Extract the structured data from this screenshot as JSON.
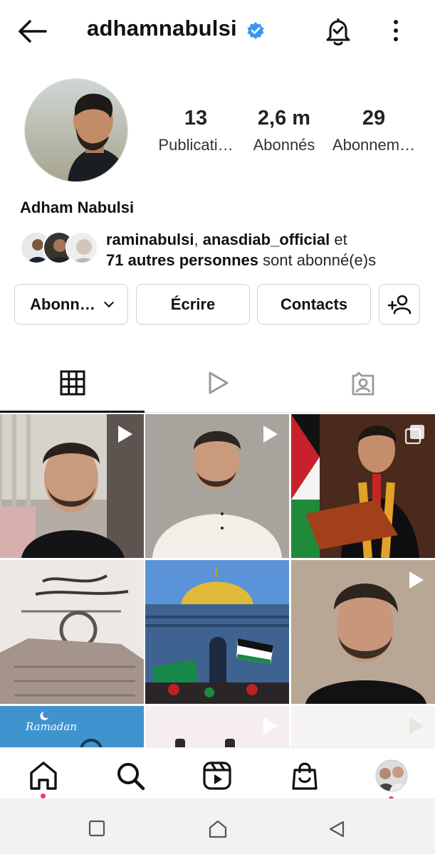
{
  "header": {
    "username": "adhamnabulsi",
    "verified": true,
    "icons": [
      "arrow-left-icon",
      "verified-badge-icon",
      "bell-check-icon",
      "more-vertical-icon"
    ]
  },
  "profile": {
    "full_name": "Adham Nabulsi",
    "stats": [
      {
        "value": "13",
        "label": "Publicati…"
      },
      {
        "value": "2,6 m",
        "label": "Abonnés"
      },
      {
        "value": "29",
        "label": "Abonnem…"
      }
    ],
    "mutual": {
      "user1": "raminabulsi",
      "sep": ", ",
      "user2": "anasdiab_official",
      "et": " et",
      "others": "71 autres personnes",
      "suffix": " sont abonné(e)s"
    }
  },
  "actions": {
    "follow_label": "Abonn…",
    "write_label": "Écrire",
    "contacts_label": "Contacts"
  },
  "tabs": [
    "grid-icon",
    "reels-play-icon",
    "tagged-person-icon"
  ],
  "grid": {
    "posts": [
      {
        "type": "video"
      },
      {
        "type": "video"
      },
      {
        "type": "carousel"
      },
      {
        "type": "image"
      },
      {
        "type": "image"
      },
      {
        "type": "video"
      },
      {
        "type": "image",
        "text": "Ramadan"
      },
      {
        "type": "video"
      },
      {
        "type": "video"
      }
    ]
  },
  "bottom_nav": [
    "home-icon",
    "search-icon",
    "reels-icon",
    "shop-icon",
    "profile-avatar"
  ],
  "colors": {
    "verified": "#3897f0",
    "notification_dot": "#ed3b5a",
    "text": "#262626"
  }
}
